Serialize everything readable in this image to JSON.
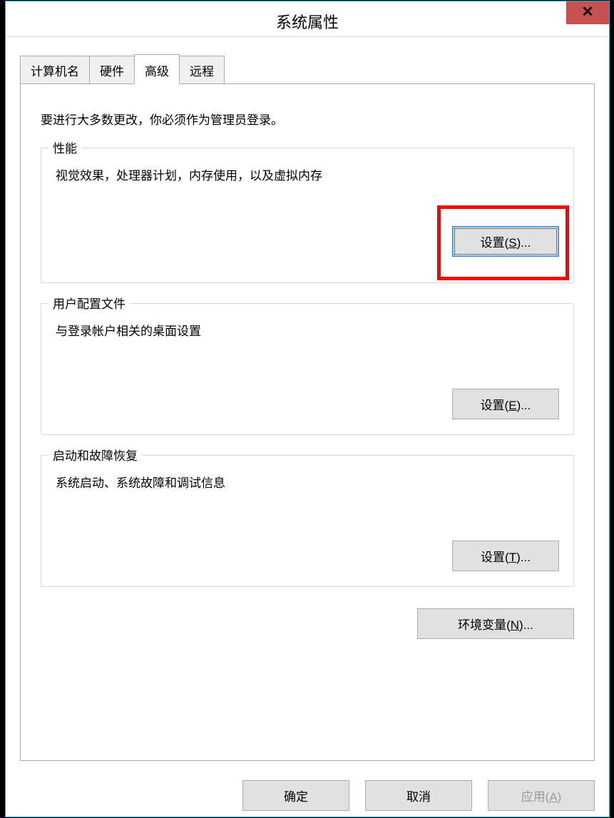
{
  "window": {
    "title": "系统属性",
    "close_glyph": "✕"
  },
  "tabs": {
    "computer_name": "计算机名",
    "hardware": "硬件",
    "advanced": "高级",
    "remote": "远程"
  },
  "advanced_panel": {
    "intro": "要进行大多数更改，你必须作为管理员登录。",
    "performance": {
      "legend": "性能",
      "desc": "视觉效果，处理器计划，内存使用，以及虚拟内存",
      "button": "设置(S)..."
    },
    "user_profiles": {
      "legend": "用户配置文件",
      "desc": "与登录帐户相关的桌面设置",
      "button": "设置(E)..."
    },
    "startup_recovery": {
      "legend": "启动和故障恢复",
      "desc": "系统启动、系统故障和调试信息",
      "button": "设置(T)..."
    },
    "env_vars_button": "环境变量(N)..."
  },
  "dialog_buttons": {
    "ok": "确定",
    "cancel": "取消",
    "apply": "应用(A)"
  }
}
